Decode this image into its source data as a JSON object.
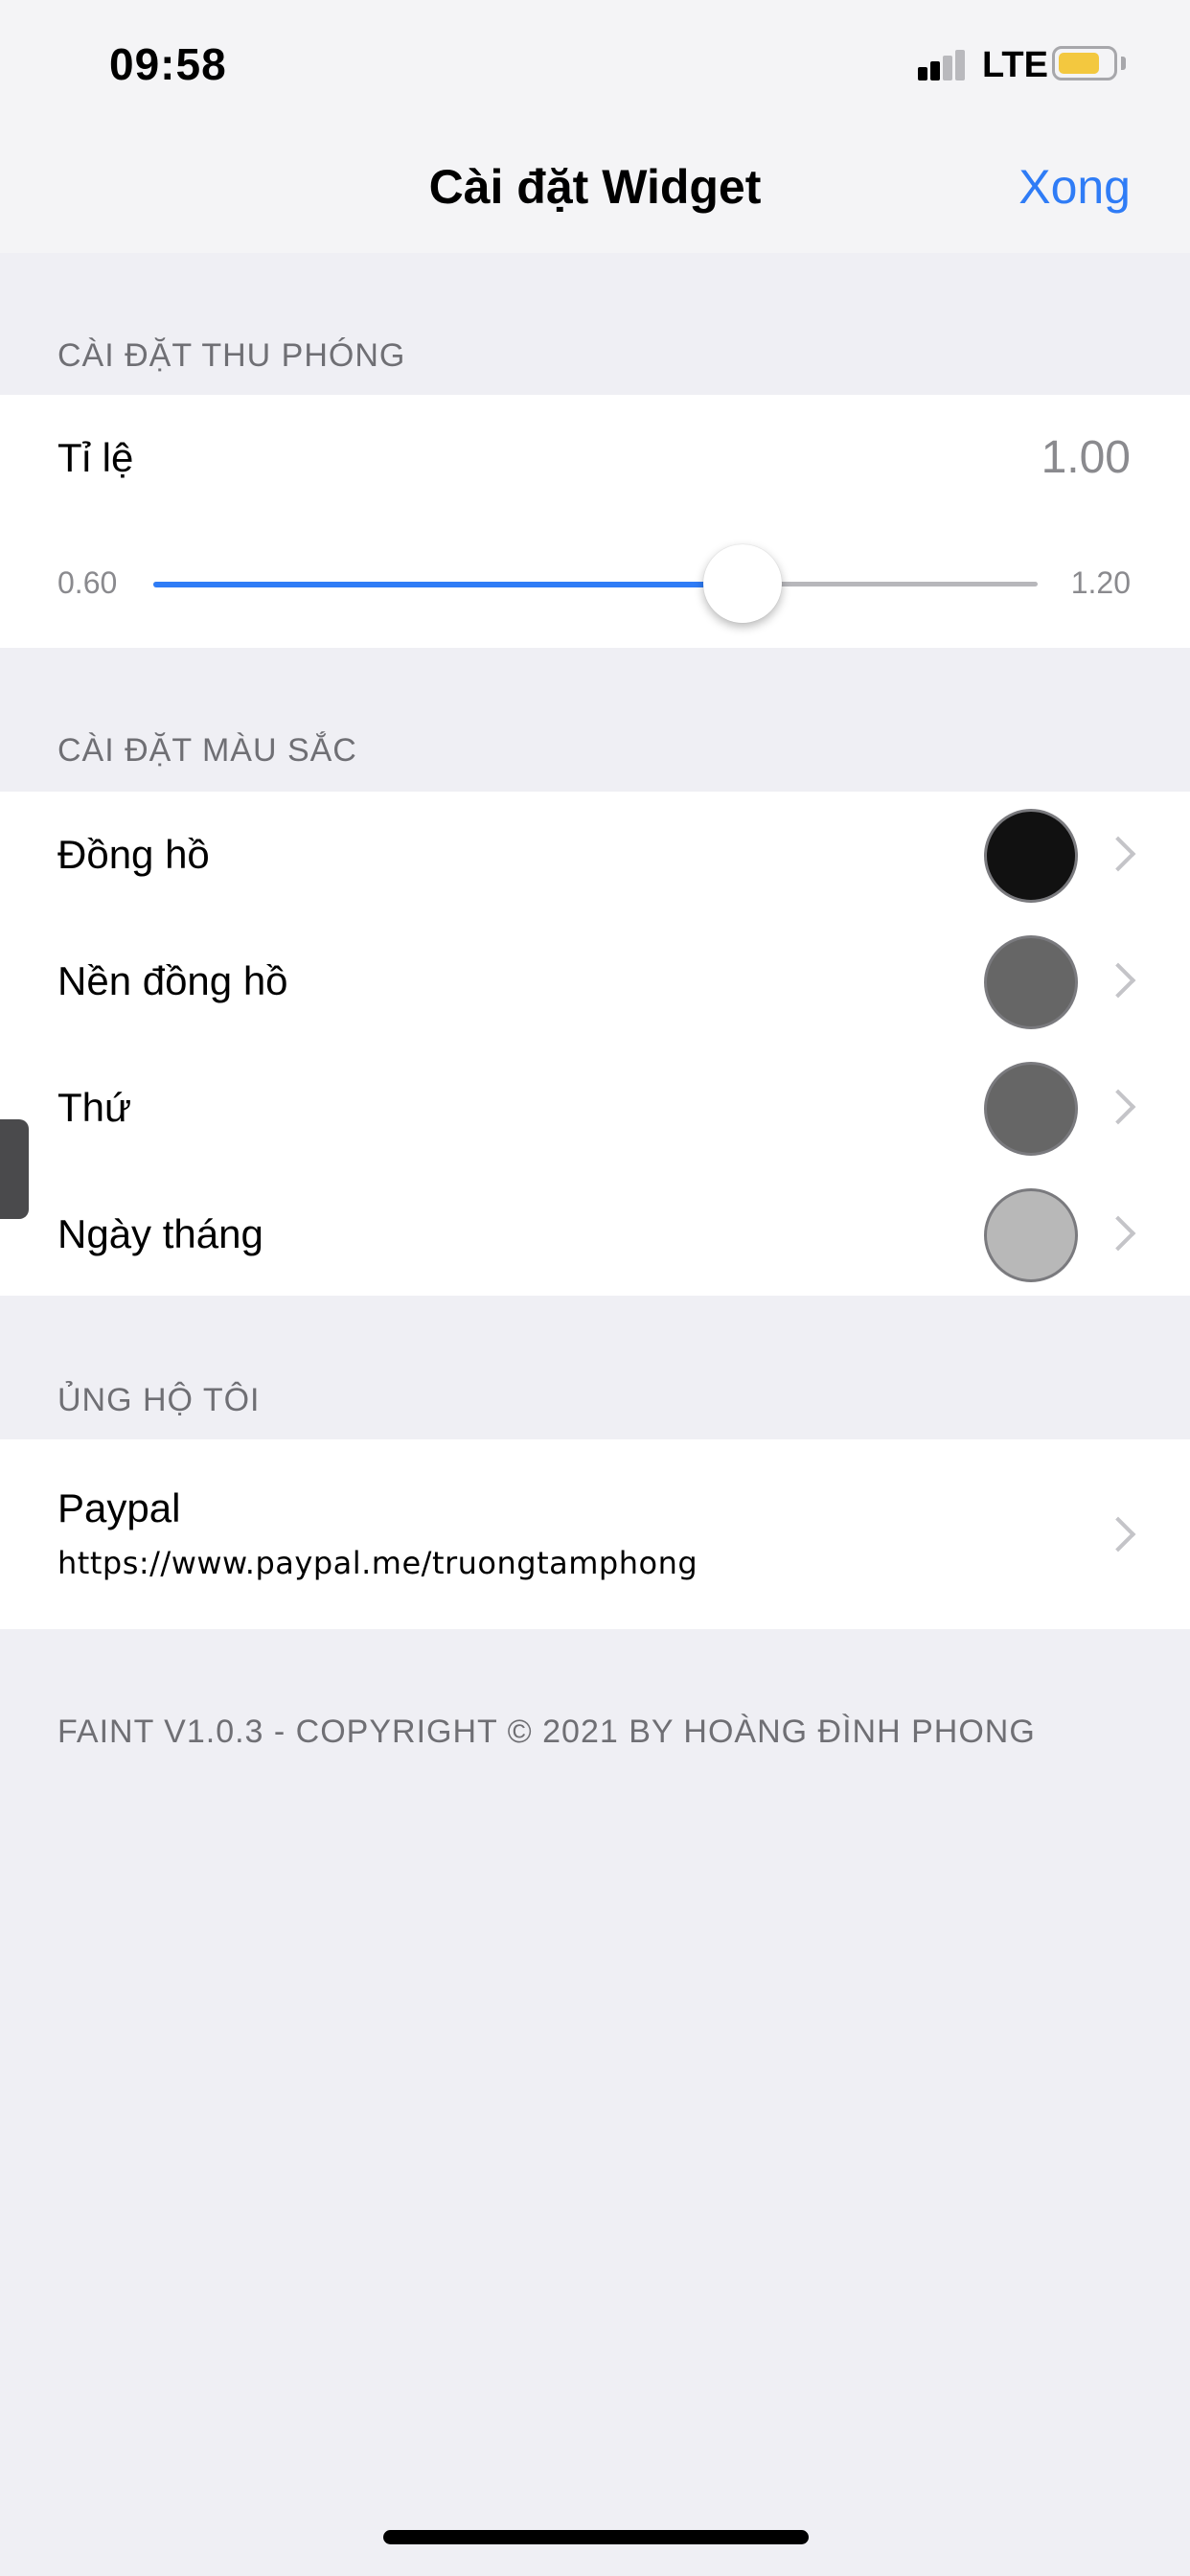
{
  "status_bar": {
    "time": "09:58",
    "network": "LTE",
    "battery_color": "#f3c83f"
  },
  "nav": {
    "title": "Cài đặt Widget",
    "done_label": "Xong"
  },
  "zoom_section": {
    "header": "CÀI ĐẶT THU PHÓNG",
    "scale_label": "Tỉ lệ",
    "scale_value": "1.00",
    "slider_min": "0.60",
    "slider_max": "1.20",
    "slider_value": 1.0
  },
  "color_section": {
    "header": "CÀI ĐẶT MÀU SẮC",
    "items": [
      {
        "label": "Đồng hồ",
        "color": "#111111"
      },
      {
        "label": "Nền đồng hồ",
        "color": "#666666"
      },
      {
        "label": "Thứ",
        "color": "#666666"
      },
      {
        "label": "Ngày tháng",
        "color": "#b8b8b8"
      }
    ]
  },
  "support_section": {
    "header": "ỦNG HỘ TÔI",
    "title": "Paypal",
    "url": "https://www.paypal.me/truongtamphong"
  },
  "footer": "FAINT V1.0.3 - COPYRIGHT © 2021 BY HOÀNG ĐÌNH PHONG",
  "colors": {
    "accent": "#2f7cf6",
    "background": "#efeff4"
  }
}
